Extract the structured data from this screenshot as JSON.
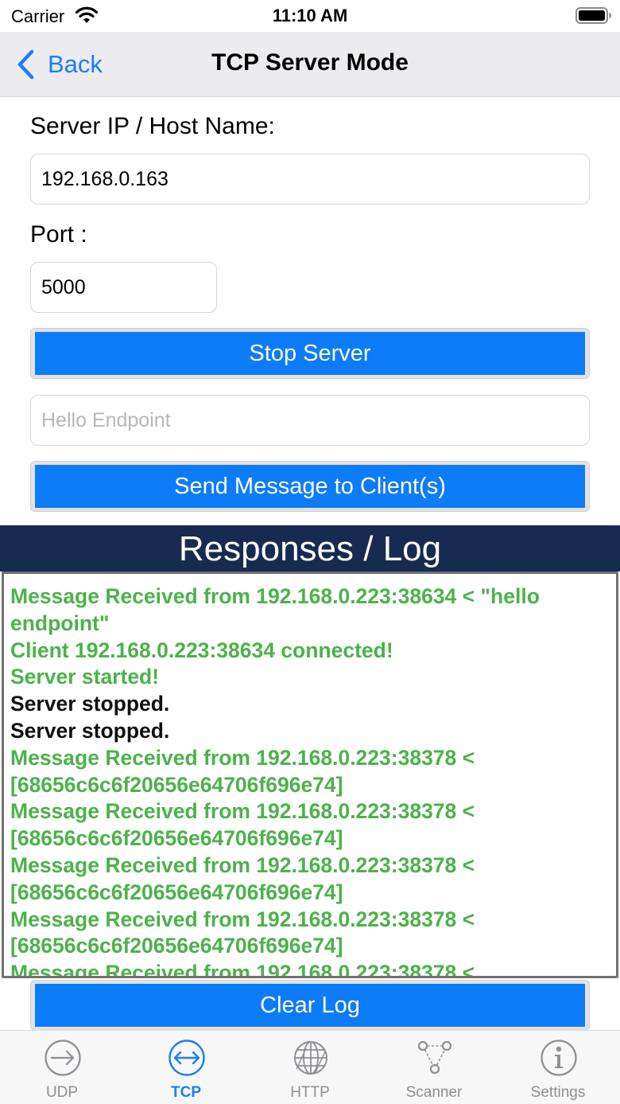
{
  "status_bar": {
    "carrier": "Carrier",
    "time": "11:10 AM"
  },
  "nav": {
    "back_label": "Back",
    "title": "TCP Server Mode"
  },
  "form": {
    "server_label": "Server IP / Host Name:",
    "server_value": "192.168.0.163",
    "port_label": "Port :",
    "port_value": "5000",
    "stop_server_label": "Stop Server",
    "message_placeholder": "Hello Endpoint",
    "message_value": "",
    "send_label": "Send Message to Client(s)"
  },
  "log": {
    "title": "Responses / Log",
    "lines": [
      {
        "text": "Message Received from 192.168.0.223:38634 < \"hello endpoint\"",
        "color": "#4cb24a"
      },
      {
        "text": "Client 192.168.0.223:38634 connected!",
        "color": "#4cb24a"
      },
      {
        "text": "Server started!",
        "color": "#4cb24a"
      },
      {
        "text": "Server stopped.",
        "color": "#111111"
      },
      {
        "text": "Server stopped.",
        "color": "#111111"
      },
      {
        "text": "Message Received from 192.168.0.223:38378 <\n[68656c6c6f20656e64706f696e74]",
        "color": "#4cb24a"
      },
      {
        "text": "Message Received from 192.168.0.223:38378 <\n[68656c6c6f20656e64706f696e74]",
        "color": "#4cb24a"
      },
      {
        "text": "Message Received from 192.168.0.223:38378 <\n[68656c6c6f20656e64706f696e74]",
        "color": "#4cb24a"
      },
      {
        "text": "Message Received from 192.168.0.223:38378 <\n[68656c6c6f20656e64706f696e74]",
        "color": "#4cb24a"
      },
      {
        "text": "Message Received from 192.168.0.223:38378 <",
        "color": "#4cb24a"
      }
    ],
    "clear_label": "Clear Log"
  },
  "tabs": [
    {
      "label": "UDP",
      "icon": "arrow-right-circle-icon",
      "active": false
    },
    {
      "label": "TCP",
      "icon": "arrows-left-right-circle-icon",
      "active": true
    },
    {
      "label": "HTTP",
      "icon": "globe-icon",
      "active": false
    },
    {
      "label": "Scanner",
      "icon": "network-nodes-icon",
      "active": false
    },
    {
      "label": "Settings",
      "icon": "info-circle-icon",
      "active": false
    }
  ],
  "colors": {
    "accent": "#0d7cf8",
    "tint": "#1a7cff",
    "log_header": "#172b52",
    "log_green": "#4cb24a",
    "tab_inactive": "#8e8e93"
  }
}
